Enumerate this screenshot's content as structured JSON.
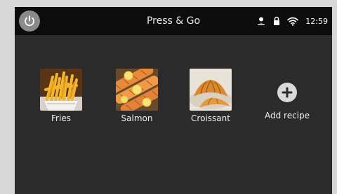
{
  "header": {
    "title": "Press & Go",
    "time": "12:59",
    "icons": [
      "power-icon",
      "user-icon",
      "lock-icon",
      "wifi-icon"
    ]
  },
  "recipes": [
    {
      "label": "Fries",
      "icon": "fries-image"
    },
    {
      "label": "Salmon",
      "icon": "salmon-image"
    },
    {
      "label": "Croissant",
      "icon": "croissant-image"
    }
  ],
  "add_recipe": {
    "label": "Add recipe",
    "icon": "plus-icon"
  },
  "colors": {
    "background": "#2b2b2b",
    "topbar": "#0d0d0d",
    "power_button": "#8a8a8a",
    "text": "#f0f0f0"
  }
}
